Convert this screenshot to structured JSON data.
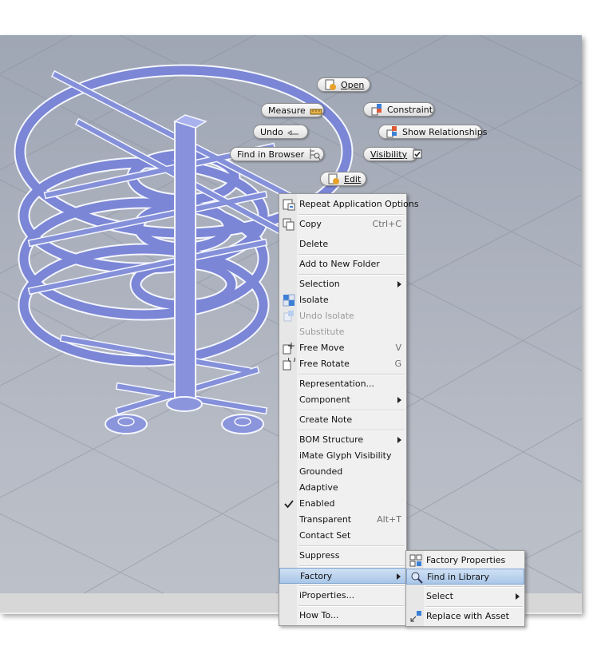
{
  "marking_menu": {
    "open": "Open",
    "measure": "Measure",
    "constraint": "Constraint",
    "undo": "Undo",
    "show_relationships": "Show Relationships",
    "find_in_browser": "Find in Browser",
    "visibility": "Visibility",
    "edit": "Edit"
  },
  "context_menu": {
    "items": [
      {
        "label": "Repeat Application Options"
      },
      {
        "label": "Copy",
        "shortcut": "Ctrl+C"
      },
      {
        "label": "Delete"
      },
      {
        "label": "Add to New Folder"
      },
      {
        "label": "Selection"
      },
      {
        "label": "Isolate"
      },
      {
        "label": "Undo Isolate"
      },
      {
        "label": "Substitute"
      },
      {
        "label": "Free Move",
        "shortcut": "V"
      },
      {
        "label": "Free Rotate",
        "shortcut": "G"
      },
      {
        "label": "Representation..."
      },
      {
        "label": "Component"
      },
      {
        "label": "Create Note"
      },
      {
        "label": "BOM Structure"
      },
      {
        "label": "iMate Glyph Visibility"
      },
      {
        "label": "Grounded"
      },
      {
        "label": "Adaptive"
      },
      {
        "label": "Enabled"
      },
      {
        "label": "Transparent",
        "shortcut": "Alt+T"
      },
      {
        "label": "Contact Set"
      },
      {
        "label": "Suppress"
      },
      {
        "label": "Factory"
      },
      {
        "label": "iProperties..."
      },
      {
        "label": "How To..."
      }
    ]
  },
  "factory_submenu": {
    "items": [
      {
        "label": "Factory Properties"
      },
      {
        "label": "Find in Library"
      },
      {
        "label": "Select"
      },
      {
        "label": "Replace with Asset"
      }
    ]
  }
}
